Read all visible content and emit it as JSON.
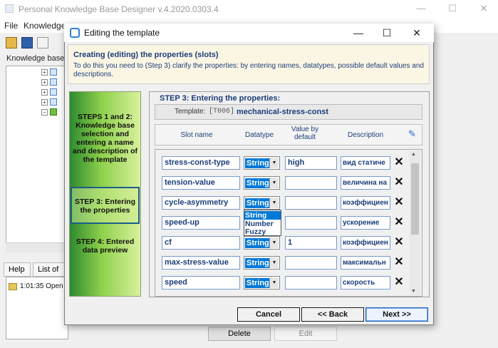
{
  "app": {
    "title": "Personal Knowledge Base Designer v.4.2020.0303.4",
    "menu": [
      "File",
      "Knowledge"
    ],
    "kb_label": "Knowledge bases",
    "tabs": [
      "Help",
      "List of"
    ],
    "log_text": "1:01:35 Open",
    "delete_label": "Delete",
    "edit_label": "Edit"
  },
  "dialog": {
    "title": "Editing the template",
    "header_title": "Creating (editing) the properties (slots)",
    "header_desc": "To do this you need to (Step 3) clarify the properties: by entering names, datatypes, possible default values and descriptions.",
    "steps": [
      {
        "label": "STEPS 1 and 2: Knowledge base selection and entering a name and description of the template"
      },
      {
        "label": "STEP 3: Entering the properties",
        "active": true
      },
      {
        "label": "STEP 4: Entered data preview"
      }
    ],
    "step3_title": "STEP 3: Entering the properties:",
    "template_label": "Template:",
    "template_code": "[T006]",
    "template_name": "mechanical-stress-const",
    "columns": [
      "Slot name",
      "Datatype",
      "Value by default",
      "Description"
    ],
    "rows": [
      {
        "name": "stress-const-type",
        "type": "String",
        "default": "high",
        "desc": "вид статиче"
      },
      {
        "name": "tension-value",
        "type": "String",
        "default": "",
        "desc": "величина на"
      },
      {
        "name": "cycle-asymmetry",
        "type": "String",
        "default": "",
        "desc": "коэффициен"
      },
      {
        "name": "speed-up",
        "type": "String",
        "default": "",
        "desc": "ускорение"
      },
      {
        "name": "cf",
        "type": "String",
        "default": "1",
        "desc": "коэффициен"
      },
      {
        "name": "max-stress-value",
        "type": "String",
        "default": "",
        "desc": "максимальн"
      },
      {
        "name": "speed",
        "type": "String",
        "default": "",
        "desc": "скорость"
      }
    ],
    "dropdown_options": [
      "String",
      "Number",
      "Fuzzy"
    ],
    "cancel_label": "Cancel",
    "back_label": "<< Back",
    "next_label": "Next >>"
  },
  "colors": {
    "accent": "#0078d7",
    "text_blue": "#1c3d7a",
    "header_bg": "#fbf6e4",
    "step_green": "#8ed14c"
  }
}
